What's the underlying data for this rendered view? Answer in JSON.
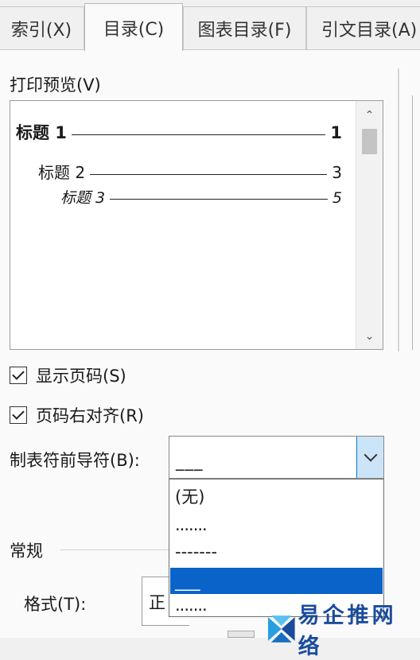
{
  "tabs": [
    {
      "label": "索引(X)",
      "active": false
    },
    {
      "label": "目录(C)",
      "active": true
    },
    {
      "label": "图表目录(F)",
      "active": false
    },
    {
      "label": "引文目录(A)",
      "active": false
    }
  ],
  "print_preview": {
    "label": "打印预览(V)",
    "lines": [
      {
        "text": "标题 1",
        "page": "1"
      },
      {
        "text": "标题 2",
        "page": "3"
      },
      {
        "text": "标题 3",
        "page": "5"
      }
    ]
  },
  "show_page_numbers": {
    "label": "显示页码(S)",
    "checked": true
  },
  "right_align_page_numbers": {
    "label": "页码右对齐(R)",
    "checked": true
  },
  "tab_leader": {
    "label": "制表符前导符(B):",
    "selected": "___",
    "options": [
      "(无)",
      ".......",
      "-------",
      "___",
      "......."
    ],
    "highlighted_index": 3
  },
  "general": {
    "label": "常规"
  },
  "formats": {
    "label": "格式(T):",
    "value": "正"
  },
  "watermark": {
    "text": "易企推网络"
  },
  "colors": {
    "selection": "#0a63c8",
    "dropdown_button": "#cce4f7",
    "watermark": "#1b4c9c"
  }
}
